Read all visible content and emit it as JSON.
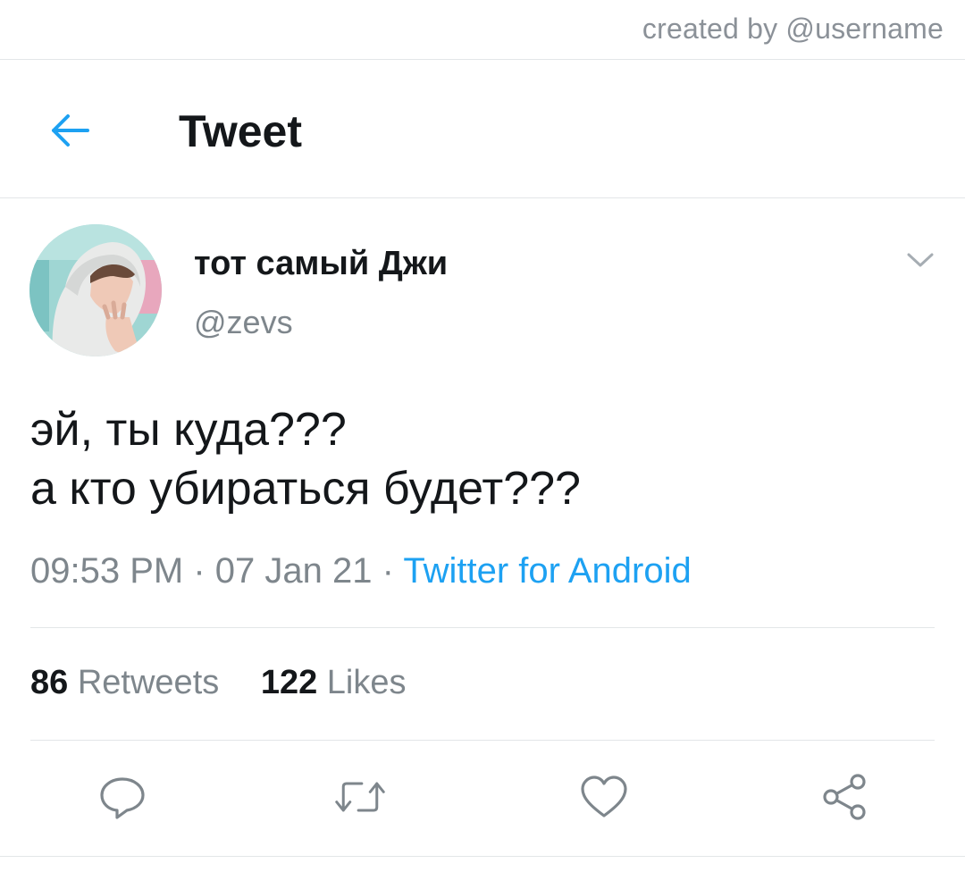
{
  "watermark": "created by @username",
  "header": {
    "back_icon": "arrow-left-icon",
    "title": "Tweet"
  },
  "tweet": {
    "author": {
      "display_name": "тот самый Джи",
      "handle": "@zevs"
    },
    "text_lines": [
      "эй, ты куда???",
      "а кто убираться будет???"
    ],
    "time": "09:53 PM",
    "date": "07 Jan 21",
    "separator": "·",
    "source": "Twitter for Android",
    "retweets": {
      "count": "86",
      "label": "Retweets"
    },
    "likes": {
      "count": "122",
      "label": "Likes"
    }
  },
  "actions": [
    {
      "icon": "reply-icon"
    },
    {
      "icon": "retweet-icon"
    },
    {
      "icon": "heart-icon"
    },
    {
      "icon": "share-icon"
    }
  ],
  "colors": {
    "accent": "#1da1f2",
    "secondary_text": "#7e868c",
    "primary_text": "#14171a",
    "divider": "#e3e6e8"
  }
}
